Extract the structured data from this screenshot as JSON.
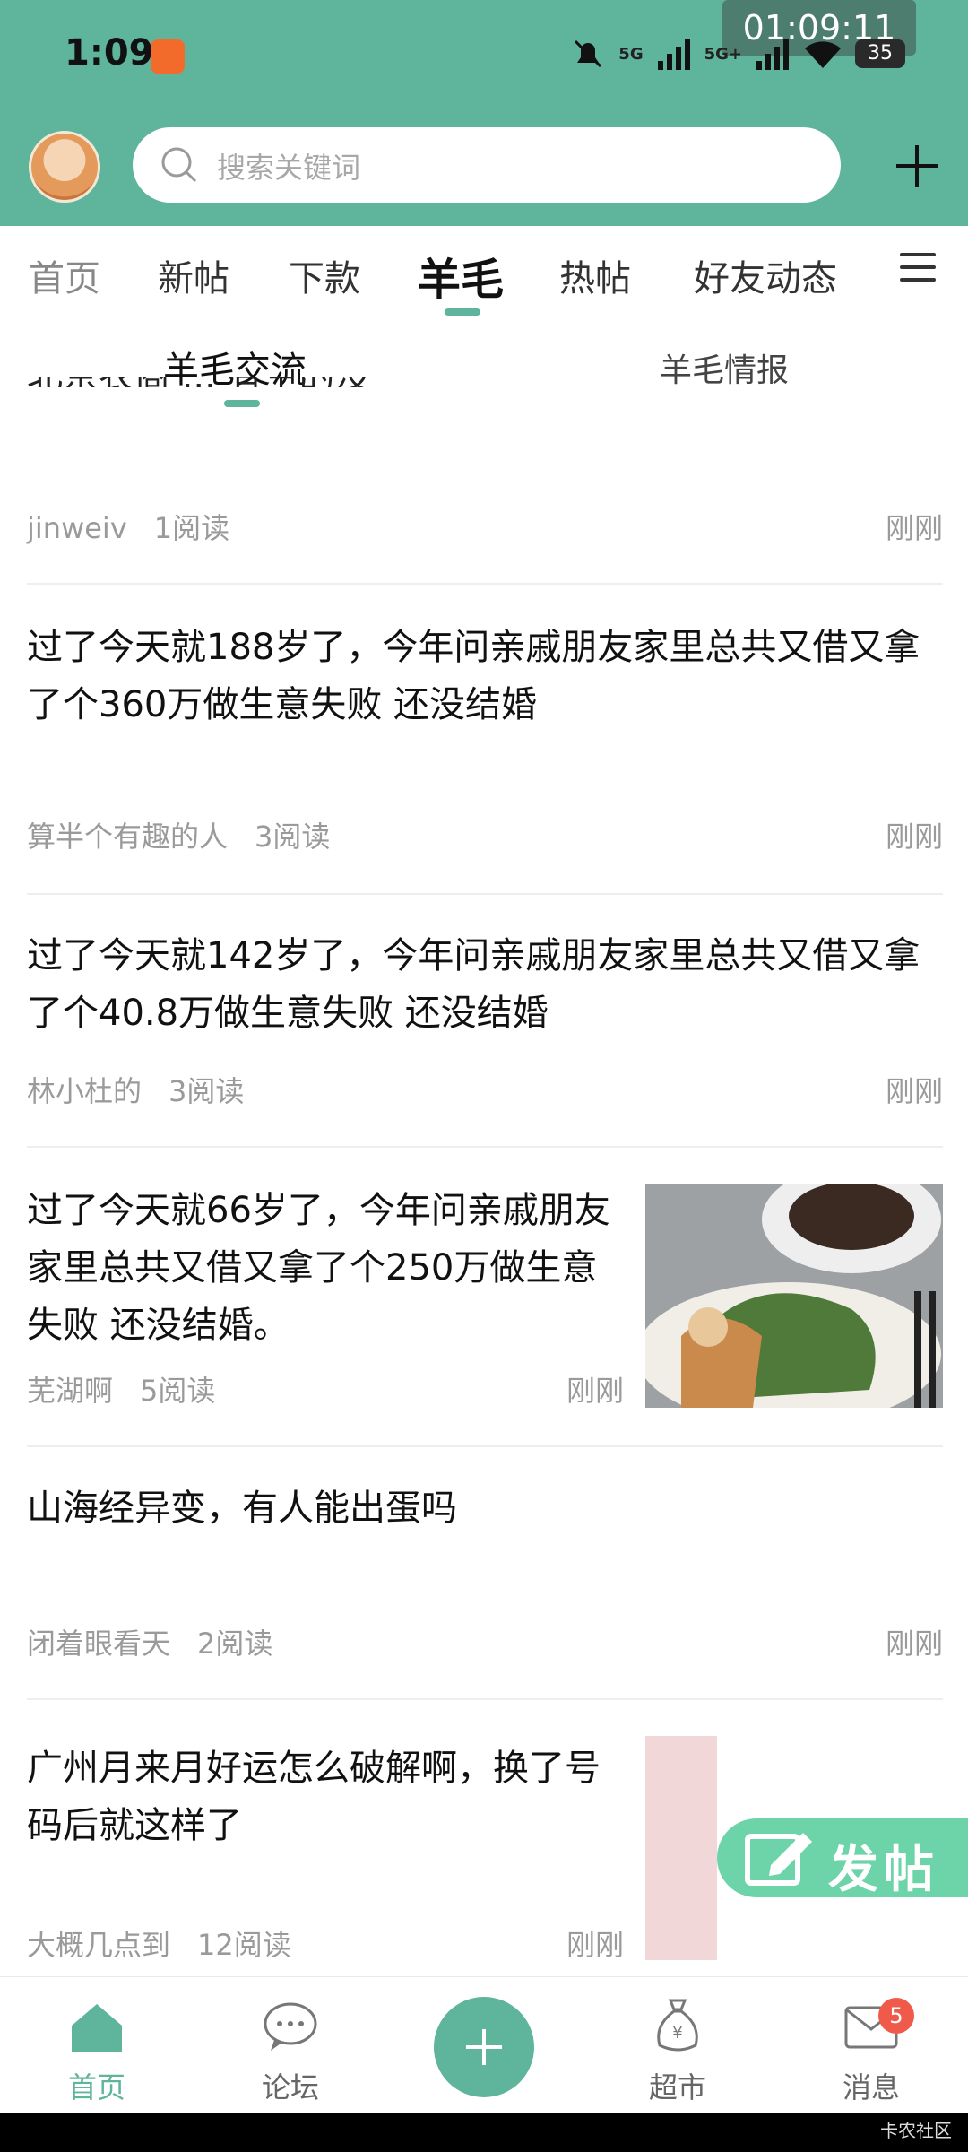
{
  "status_bar": {
    "time": "1:09",
    "clock": "01:09:11",
    "battery": "35",
    "signal_1": "5G",
    "signal_2": "5G+"
  },
  "search": {
    "placeholder": "搜索关键词"
  },
  "tabs": [
    "首页",
    "新帖",
    "下款",
    "羊毛",
    "热帖",
    "好友动态"
  ],
  "active_tab": "羊毛",
  "subtabs": [
    "羊毛交流",
    "羊毛情报"
  ],
  "partial_post": {
    "title": "北京农商 ... 有空的没",
    "author": "jinweiv",
    "reads": "1阅读",
    "time": "刚刚"
  },
  "posts": [
    {
      "title": "过了今天就188岁了，今年问亲戚朋友家里总共又借又拿了个360万做生意失败 还没结婚",
      "author": "算半个有趣的人",
      "reads": "3阅读",
      "time": "刚刚"
    },
    {
      "title": "过了今天就142岁了，今年问亲戚朋友家里总共又借又拿了个40.8万做生意失败 还没结婚",
      "author": "林小杜的",
      "reads": "3阅读",
      "time": "刚刚"
    },
    {
      "title": "过了今天就66岁了，今年问亲戚朋友家里总共又借又拿了个250万做生意失败 还没结婚。",
      "author": "芜湖啊",
      "reads": "5阅读",
      "time": "刚刚"
    },
    {
      "title": "山海经异变，有人能出蛋吗",
      "author": "闭着眼看天",
      "reads": "2阅读",
      "time": "刚刚"
    },
    {
      "title": "广州月来月好运怎么破解啊，换了号码后就这样了",
      "author": "大概几点到",
      "reads": "12阅读",
      "time": "刚刚"
    }
  ],
  "fab": {
    "label": "发帖"
  },
  "bottom_nav": {
    "home": "首页",
    "forum": "论坛",
    "market": "超市",
    "messages": "消息",
    "badge": "5"
  },
  "watermark": "卡农社区",
  "colors": {
    "brand": "#5fb49c",
    "fab": "#6dd3a8",
    "badge": "#f05a4a"
  }
}
